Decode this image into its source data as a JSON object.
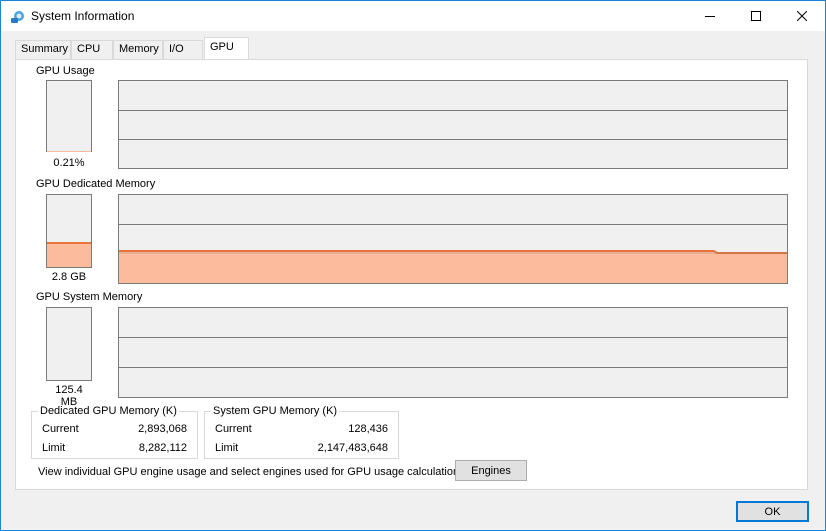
{
  "window": {
    "title": "System Information"
  },
  "tabs": [
    {
      "label": "Summary"
    },
    {
      "label": "CPU"
    },
    {
      "label": "Memory"
    },
    {
      "label": "I/O"
    },
    {
      "label": "GPU",
      "active": true
    }
  ],
  "gpu_usage": {
    "label": "GPU Usage",
    "value": "0.21%",
    "fill_fraction": 0.0021
  },
  "gpu_dedicated": {
    "label": "GPU Dedicated Memory",
    "value": "2.8 GB",
    "fill_fraction": 0.35
  },
  "gpu_system": {
    "label": "GPU System Memory",
    "value": "125.4 MB",
    "fill_fraction": 0.0
  },
  "dedicated_group": {
    "title": "Dedicated GPU Memory (K)",
    "current_label": "Current",
    "current": "2,893,068",
    "limit_label": "Limit",
    "limit": "8,282,112"
  },
  "system_group": {
    "title": "System GPU Memory (K)",
    "current_label": "Current",
    "current": "128,436",
    "limit_label": "Limit",
    "limit": "2,147,483,648"
  },
  "engines_text": "View individual GPU engine usage and select engines used for GPU usage calculations:",
  "buttons": {
    "engines": "Engines",
    "ok": "OK"
  },
  "colors": {
    "memory_fill": "#fbbb9c",
    "memory_line": "#e8743c",
    "accent": "#0078d7"
  }
}
